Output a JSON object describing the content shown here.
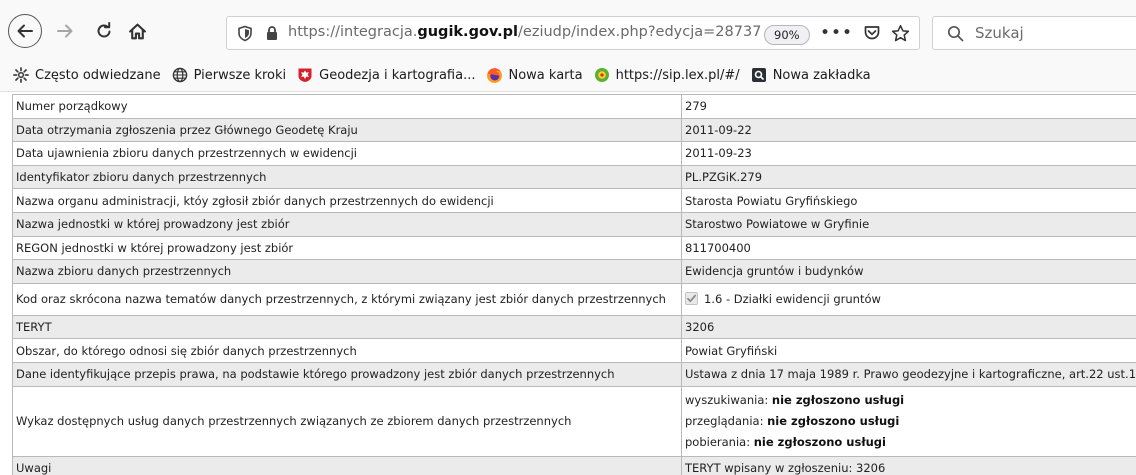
{
  "browser": {
    "url": {
      "prefix": "https://integracja.",
      "host": "gugik.gov.pl",
      "path": "/eziudp/index.php?edycja=28737"
    },
    "zoom": "90%",
    "search_placeholder": "Szukaj"
  },
  "bookmarks": [
    {
      "label": "Często odwiedzane",
      "icon": "gear-icon"
    },
    {
      "label": "Pierwsze kroki",
      "icon": "globe-icon"
    },
    {
      "label": "Geodezja i kartografia...",
      "icon": "eagle-emblem-icon"
    },
    {
      "label": "Nowa karta",
      "icon": "firefox-icon"
    },
    {
      "label": "https://sip.lex.pl/#/",
      "icon": "lex-icon"
    },
    {
      "label": "Nowa zakładka",
      "icon": "bookmark-page-icon"
    }
  ],
  "table": {
    "rows": [
      {
        "label": "Numer porządkowy",
        "value": "279"
      },
      {
        "label": "Data otrzymania zgłoszenia przez Głównego Geodetę Kraju",
        "value": "2011-09-22"
      },
      {
        "label": "Data ujawnienia zbioru danych przestrzennych w ewidencji",
        "value": "2011-09-23"
      },
      {
        "label": "Identyfikator zbioru danych przestrzennych",
        "value": "PL.PZGiK.279"
      },
      {
        "label": "Nazwa organu administracji, któy zgłosił zbiór danych przestrzennych do ewidencji",
        "value": "Starosta Powiatu Gryfińskiego"
      },
      {
        "label": "Nazwa jednostki w której prowadzony jest zbiór",
        "value": "Starostwo Powiatowe w Gryfinie"
      },
      {
        "label": "REGON jednostki w której prowadzony jest zbiór",
        "value": "811700400"
      },
      {
        "label": "Nazwa zbioru danych przestrzennych",
        "value": "Ewidencja gruntów i budynków"
      },
      {
        "label": "Kod oraz skrócona nazwa tematów danych przestrzennych, z którymi związany jest zbiór danych przestrzennych",
        "value": "1.6 - Działki ewidencji gruntów",
        "checked": true
      },
      {
        "label": "TERYT",
        "value": "3206"
      },
      {
        "label": "Obszar, do którego odnosi się zbiór danych przestrzennych",
        "value": "Powiat Gryfiński"
      },
      {
        "label": "Dane identyfikujące przepis prawa, na podstawie którego prowadzony jest zbiór danych przestrzennych",
        "value": "Ustawa z dnia 17 maja 1989 r. Prawo geodezyjne i kartograficzne, art.22 ust.1"
      },
      {
        "label": "Wykaz dostępnych usług danych przestrzennych związanych ze zbiorem danych przestrzennych",
        "services": [
          {
            "name": "wyszukiwania",
            "status": "nie zgłoszono usługi"
          },
          {
            "name": "przeglądania",
            "status": "nie zgłoszono usługi"
          },
          {
            "name": "pobierania",
            "status": "nie zgłoszono usługi"
          }
        ]
      },
      {
        "label": "Uwagi",
        "value": "TERYT wpisany w zgłoszeniu: 3206"
      }
    ]
  }
}
